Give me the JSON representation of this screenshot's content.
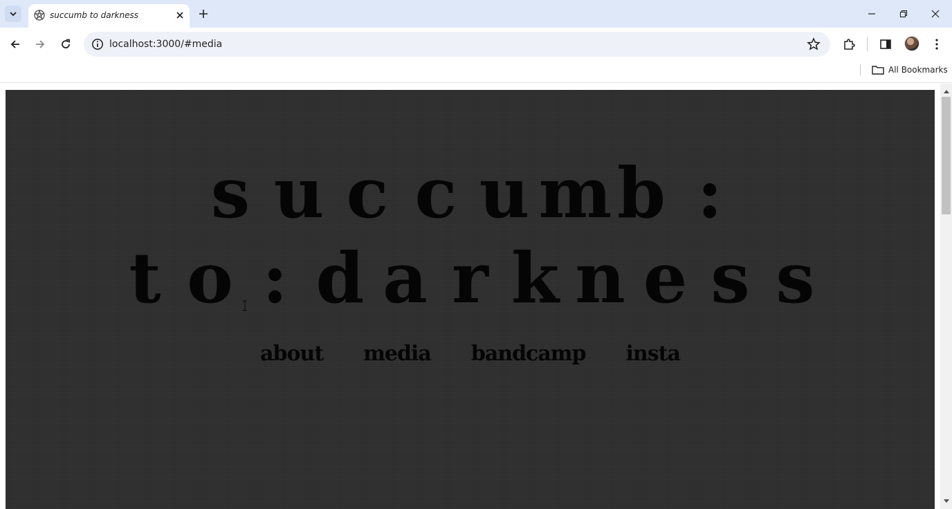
{
  "browser": {
    "tab": {
      "title": "succumb to darkness",
      "favicon": "pentagram-icon"
    },
    "address_bar": {
      "url": "localhost:3000/#media"
    },
    "bookmarks": {
      "all_bookmarks_label": "All Bookmarks"
    },
    "colors": {
      "tabstrip": "#dee8f8",
      "omnibox": "#eef1f8"
    }
  },
  "page": {
    "title_line_1": [
      "s",
      "u",
      "c",
      "c",
      "u",
      "m",
      "b",
      ":"
    ],
    "title_line_2": [
      "t",
      "o",
      ":",
      "d",
      "a",
      "r",
      "k",
      "n",
      "e",
      "s",
      "s"
    ],
    "nav": {
      "about": "about",
      "media": "media",
      "bandcamp": "bandcamp",
      "insta": "insta"
    },
    "colors": {
      "background": "#2f2f2f",
      "text": "#050505"
    }
  }
}
